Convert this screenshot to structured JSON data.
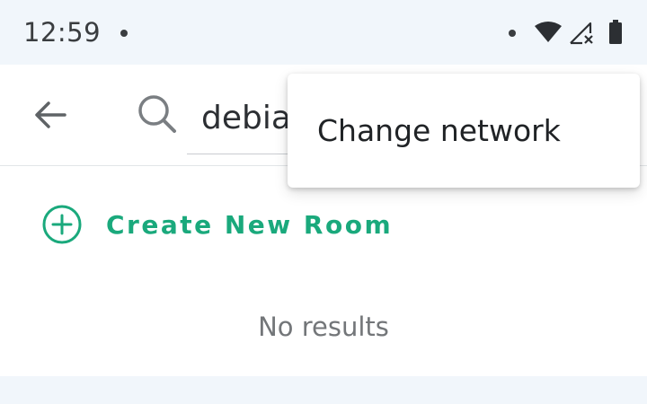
{
  "status_bar": {
    "time": "12:59",
    "icons": [
      "notification-dot-icon",
      "wifi-icon",
      "signal-no-data-icon",
      "battery-icon"
    ]
  },
  "app_bar": {
    "back_icon": "arrow-left-icon",
    "search_icon": "search-icon",
    "search_value": "debian"
  },
  "content": {
    "create_room_icon": "plus-circle-icon",
    "create_room_label": "Create New Room",
    "no_results": "No results"
  },
  "popup_menu": {
    "items": [
      {
        "label": "Change network"
      }
    ]
  },
  "colors": {
    "accent": "#1aa97c",
    "status_bar_bg": "#f1f6fb",
    "surface": "#ffffff",
    "text_primary": "#202326",
    "text_secondary": "#737679"
  }
}
